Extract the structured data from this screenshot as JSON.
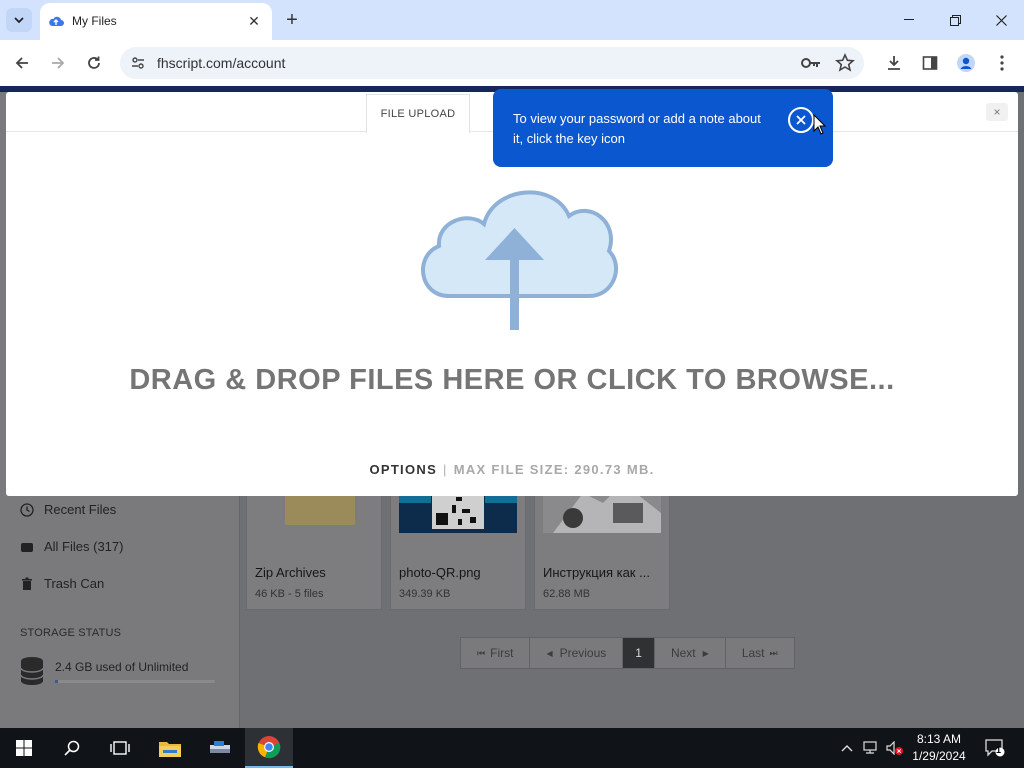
{
  "browser": {
    "tab_title": "My Files",
    "url": "fhscript.com/account"
  },
  "password_bubble": {
    "text": "To view your password or add a note about it, click the key icon"
  },
  "modal": {
    "tab_label": "FILE UPLOAD",
    "close_label": "×",
    "drop_text": "DRAG & DROP FILES HERE OR CLICK TO BROWSE...",
    "options_label": "OPTIONS",
    "separator": "|",
    "max_size": "MAX FILE SIZE: 290.73 MB."
  },
  "sidebar": {
    "items": [
      {
        "label": "Recent Files",
        "icon": "clock-icon"
      },
      {
        "label": "All Files (317)",
        "icon": "drive-icon"
      },
      {
        "label": "Trash Can",
        "icon": "trash-icon"
      }
    ],
    "storage_title": "STORAGE STATUS",
    "storage_text": "2.4 GB used of Unlimited",
    "storage_used_fraction": 0.02
  },
  "files": [
    {
      "name": "Zip Archives",
      "meta": "46 KB - 5 files"
    },
    {
      "name": "photo-QR.png",
      "meta": "349.39 KB"
    },
    {
      "name": "Инструкция как ...",
      "meta": "62.88 MB"
    }
  ],
  "pagination": {
    "first": "First",
    "previous": "Previous",
    "current": "1",
    "next": "Next",
    "last": "Last"
  },
  "taskbar": {
    "time": "8:13 AM",
    "date": "1/29/2024",
    "notification_count": "1"
  },
  "colors": {
    "accent": "#0b57d0",
    "tab_strip": "#d3e3fd"
  }
}
